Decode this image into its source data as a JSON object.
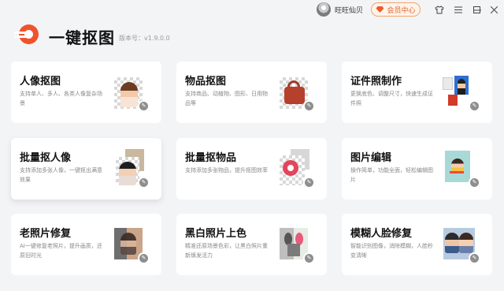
{
  "header": {
    "username": "旺旺仙贝",
    "vip_label": "会员中心",
    "app_title": "一键抠图",
    "version": "版本号：v1.9.0.0"
  },
  "window_controls": [
    "shirt-icon",
    "menu-icon",
    "minimize-icon",
    "maximize-icon",
    "close-icon"
  ],
  "cards": [
    {
      "title": "人像抠图",
      "desc": "支持单人、多人、各类人像复杂场景",
      "icon": "portrait-cutout-icon"
    },
    {
      "title": "物品抠图",
      "desc": "支持商品、动植物、图形、日用物品等",
      "icon": "object-cutout-icon"
    },
    {
      "title": "证件照制作",
      "desc": "更换底色、调整尺寸，快速生成证件照",
      "icon": "id-photo-icon"
    },
    {
      "title": "批量抠人像",
      "desc": "支持添加多张人像，一键抠出满意效果",
      "icon": "batch-portrait-icon"
    },
    {
      "title": "批量抠物品",
      "desc": "支持添加多张物品，提升抠图效率",
      "icon": "batch-object-icon"
    },
    {
      "title": "图片编辑",
      "desc": "操作简单，功能全面，轻松编辑图片",
      "icon": "image-edit-icon"
    },
    {
      "title": "老照片修复",
      "desc": "AI一键修复老照片，提升画质，还原旧时光",
      "icon": "old-photo-icon"
    },
    {
      "title": "黑白照片上色",
      "desc": "精准还原场景色彩，让黑白照片重新焕发活力",
      "icon": "colorize-icon"
    },
    {
      "title": "模糊人脸修复",
      "desc": "智能识别图像，消除模糊，人脸秒变清晰",
      "icon": "face-restore-icon"
    }
  ],
  "colors": {
    "brand": "#f0532c",
    "vip_border": "#f3a36c",
    "background": "#f3f4f6"
  }
}
